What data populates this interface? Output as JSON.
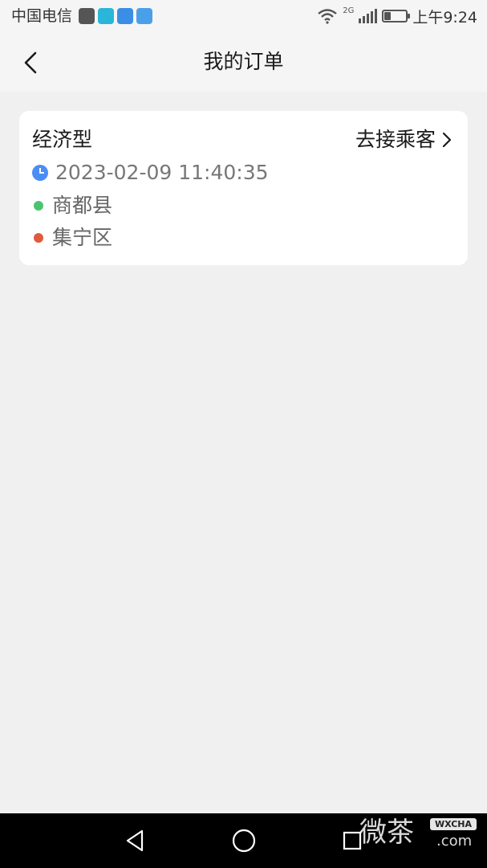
{
  "status_bar": {
    "carrier": "中国电信",
    "network": "2G",
    "time": "上午9:24",
    "battery_level": 0.3,
    "app_icons": [
      "huawei-app-icon",
      "tablet-app-icon",
      "shield-app-icon",
      "layers-app-icon"
    ]
  },
  "header": {
    "title": "我的订单",
    "back_icon": "chevron-left-icon"
  },
  "order": {
    "type": "经济型",
    "action_label": "去接乘客",
    "action_icon": "chevron-right-icon",
    "datetime": "2023-02-09 11:40:35",
    "origin": "商都县",
    "destination": "集宁区",
    "colors": {
      "clock": "#4a8df5",
      "origin_dot": "#4cc46e",
      "destination_dot": "#e05a3c"
    }
  },
  "nav_bar": {
    "buttons": [
      "back-triangle-icon",
      "home-circle-icon",
      "recent-square-icon"
    ]
  },
  "watermark": {
    "text": "微茶",
    "badge": "WXCHA",
    "domain": ".com"
  }
}
